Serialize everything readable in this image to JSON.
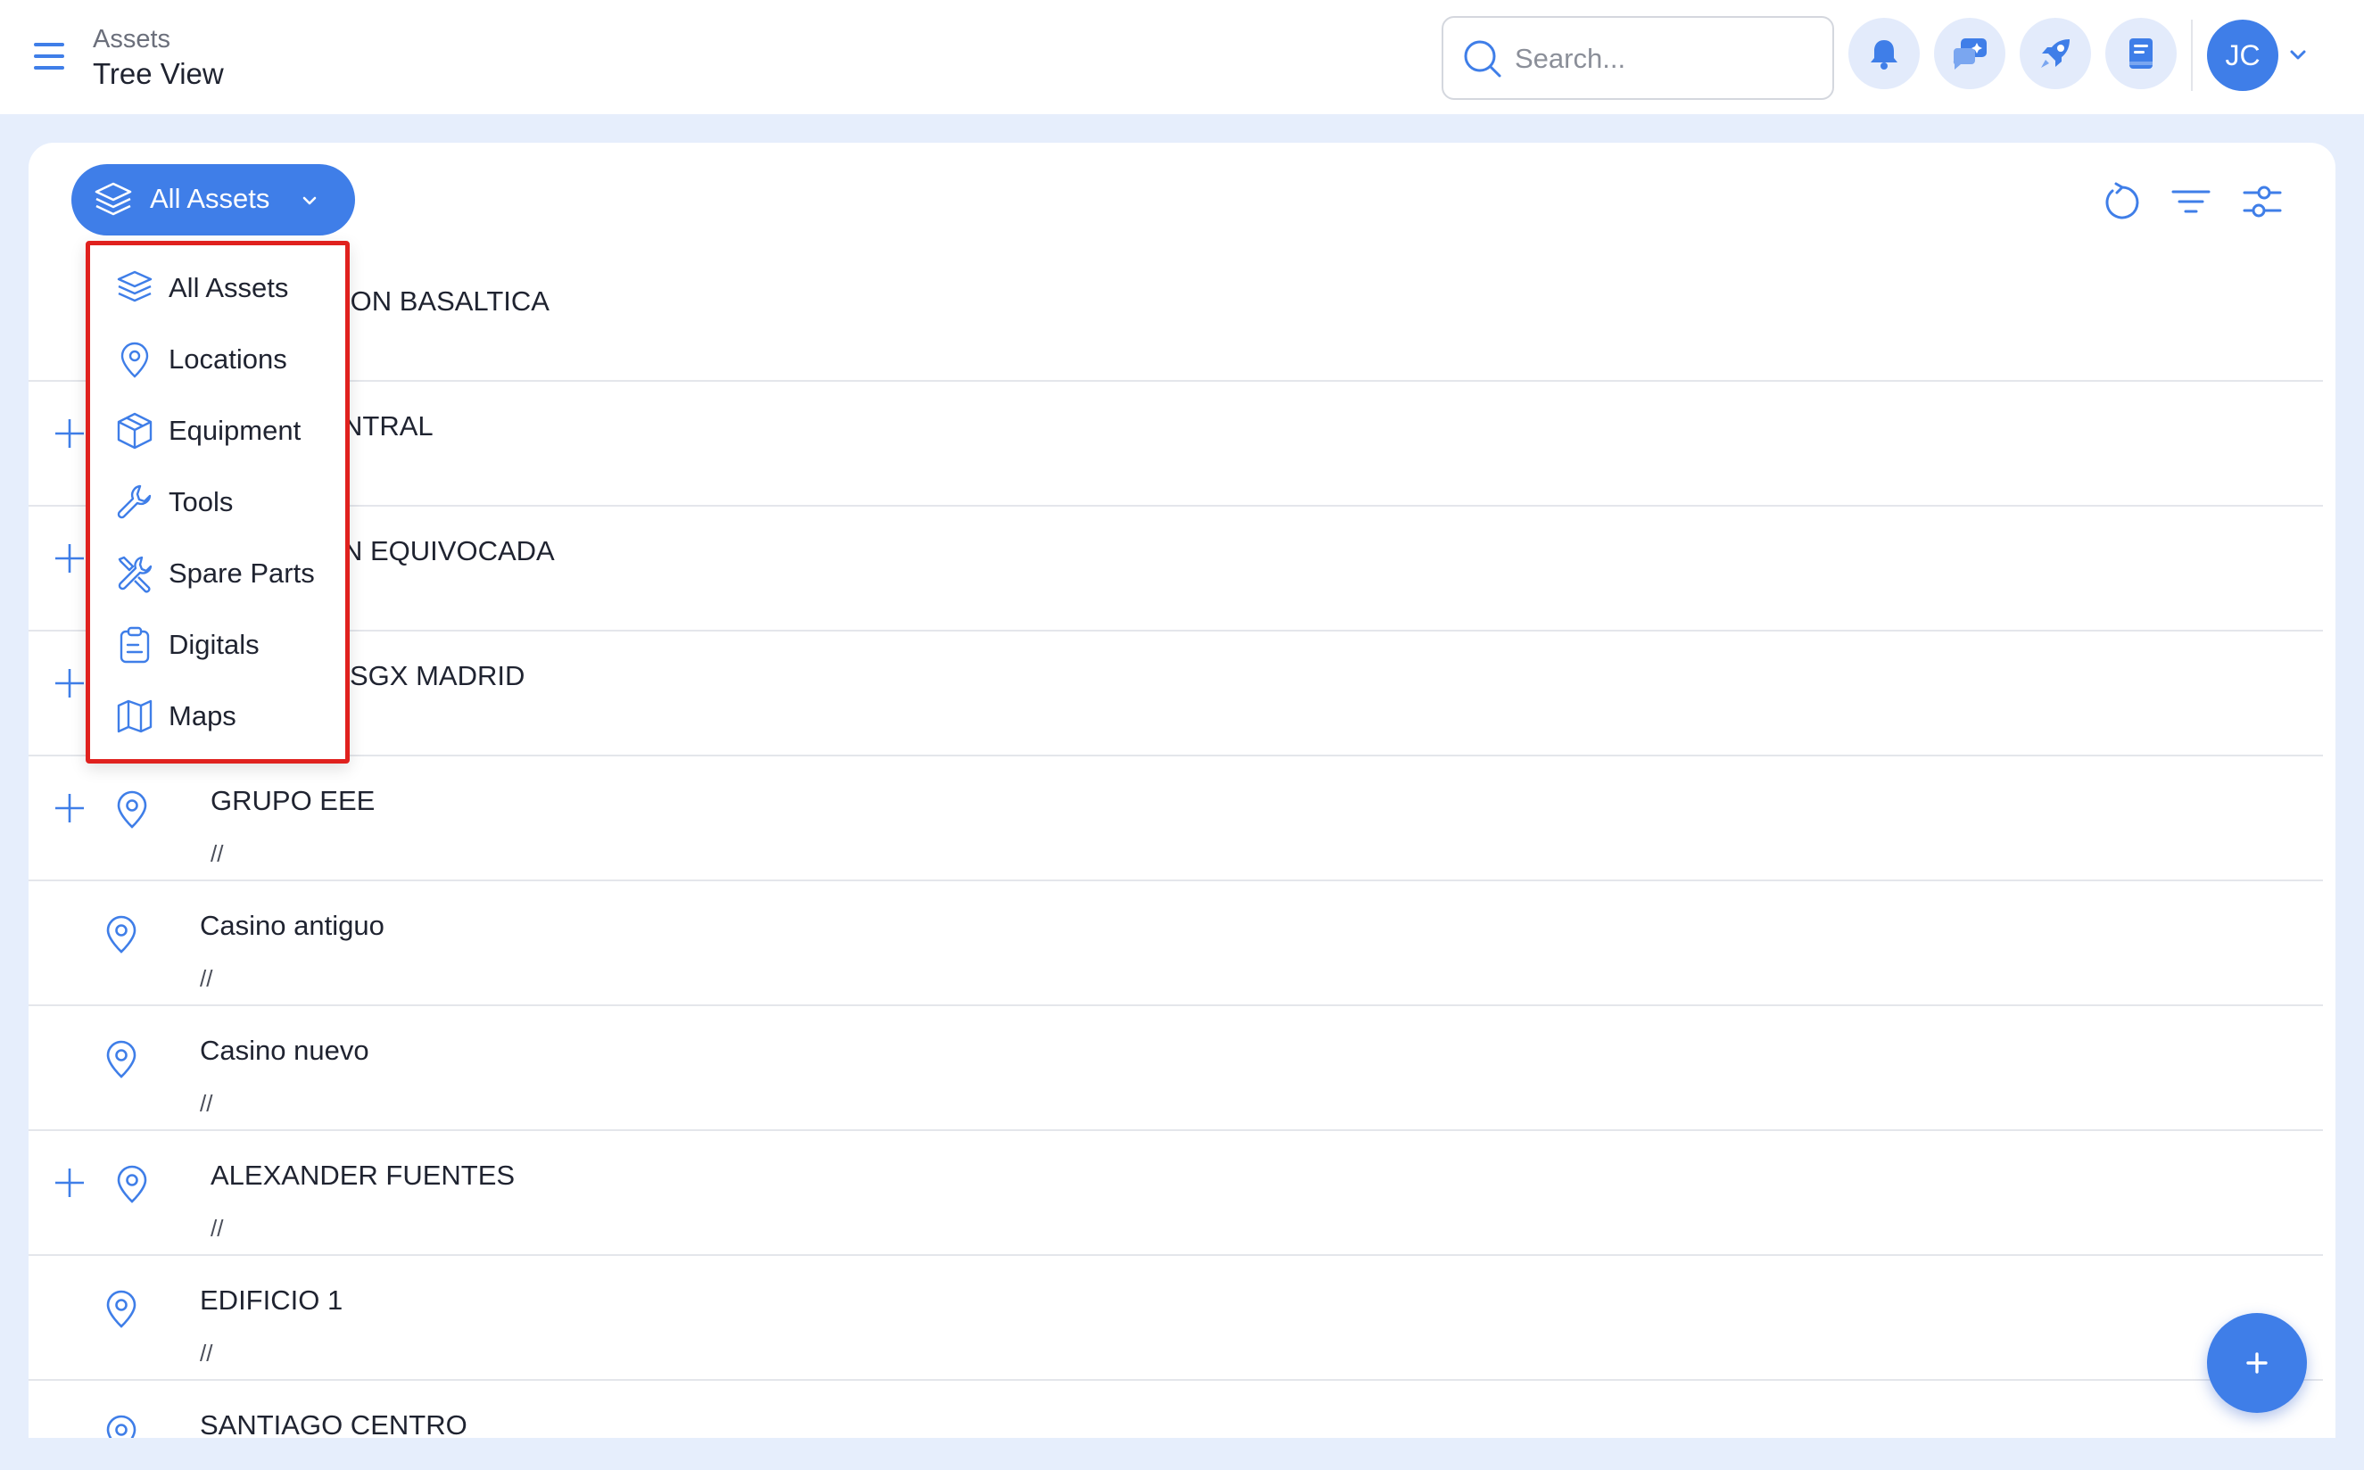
{
  "header": {
    "breadcrumb_parent": "Assets",
    "title": "Tree View",
    "search_placeholder": "Search...",
    "avatar_initials": "JC",
    "icons": [
      "menu-icon",
      "search-icon",
      "bell-icon",
      "chat-icon",
      "rocket-icon",
      "book-icon",
      "chevron-down-icon"
    ]
  },
  "toolbar": {
    "filter_button_label": "All Assets",
    "icons": [
      "refresh-icon",
      "filter-icon",
      "settings-sliders-icon"
    ]
  },
  "dropdown": {
    "items": [
      {
        "label": "All Assets",
        "icon": "layers-icon"
      },
      {
        "label": "Locations",
        "icon": "location-pin-icon"
      },
      {
        "label": "Equipment",
        "icon": "box-icon"
      },
      {
        "label": "Tools",
        "icon": "wrench-icon"
      },
      {
        "label": "Spare Parts",
        "icon": "tools-crossed-icon"
      },
      {
        "label": "Digitals",
        "icon": "clipboard-icon"
      },
      {
        "label": "Maps",
        "icon": "map-icon"
      }
    ]
  },
  "tree": {
    "rows": [
      {
        "name": "ION BASALTICA",
        "path": ""
      },
      {
        "name": "NTRAL",
        "path": ""
      },
      {
        "name": "N EQUIVOCADA",
        "path": ""
      },
      {
        "name": "SGX MADRID",
        "path": ""
      },
      {
        "name": "GRUPO EEE",
        "path": "//"
      },
      {
        "name": "Casino antiguo",
        "path": "//"
      },
      {
        "name": "Casino nuevo",
        "path": "//"
      },
      {
        "name": "ALEXANDER FUENTES",
        "path": "//"
      },
      {
        "name": "EDIFICIO 1",
        "path": "//"
      },
      {
        "name": "SANTIAGO CENTRO",
        "path": ""
      }
    ]
  },
  "fab": {
    "icon": "plus-icon"
  },
  "colors": {
    "accent": "#3f7ee8",
    "highlight_border": "#e0211e",
    "background": "#e6eefc"
  }
}
